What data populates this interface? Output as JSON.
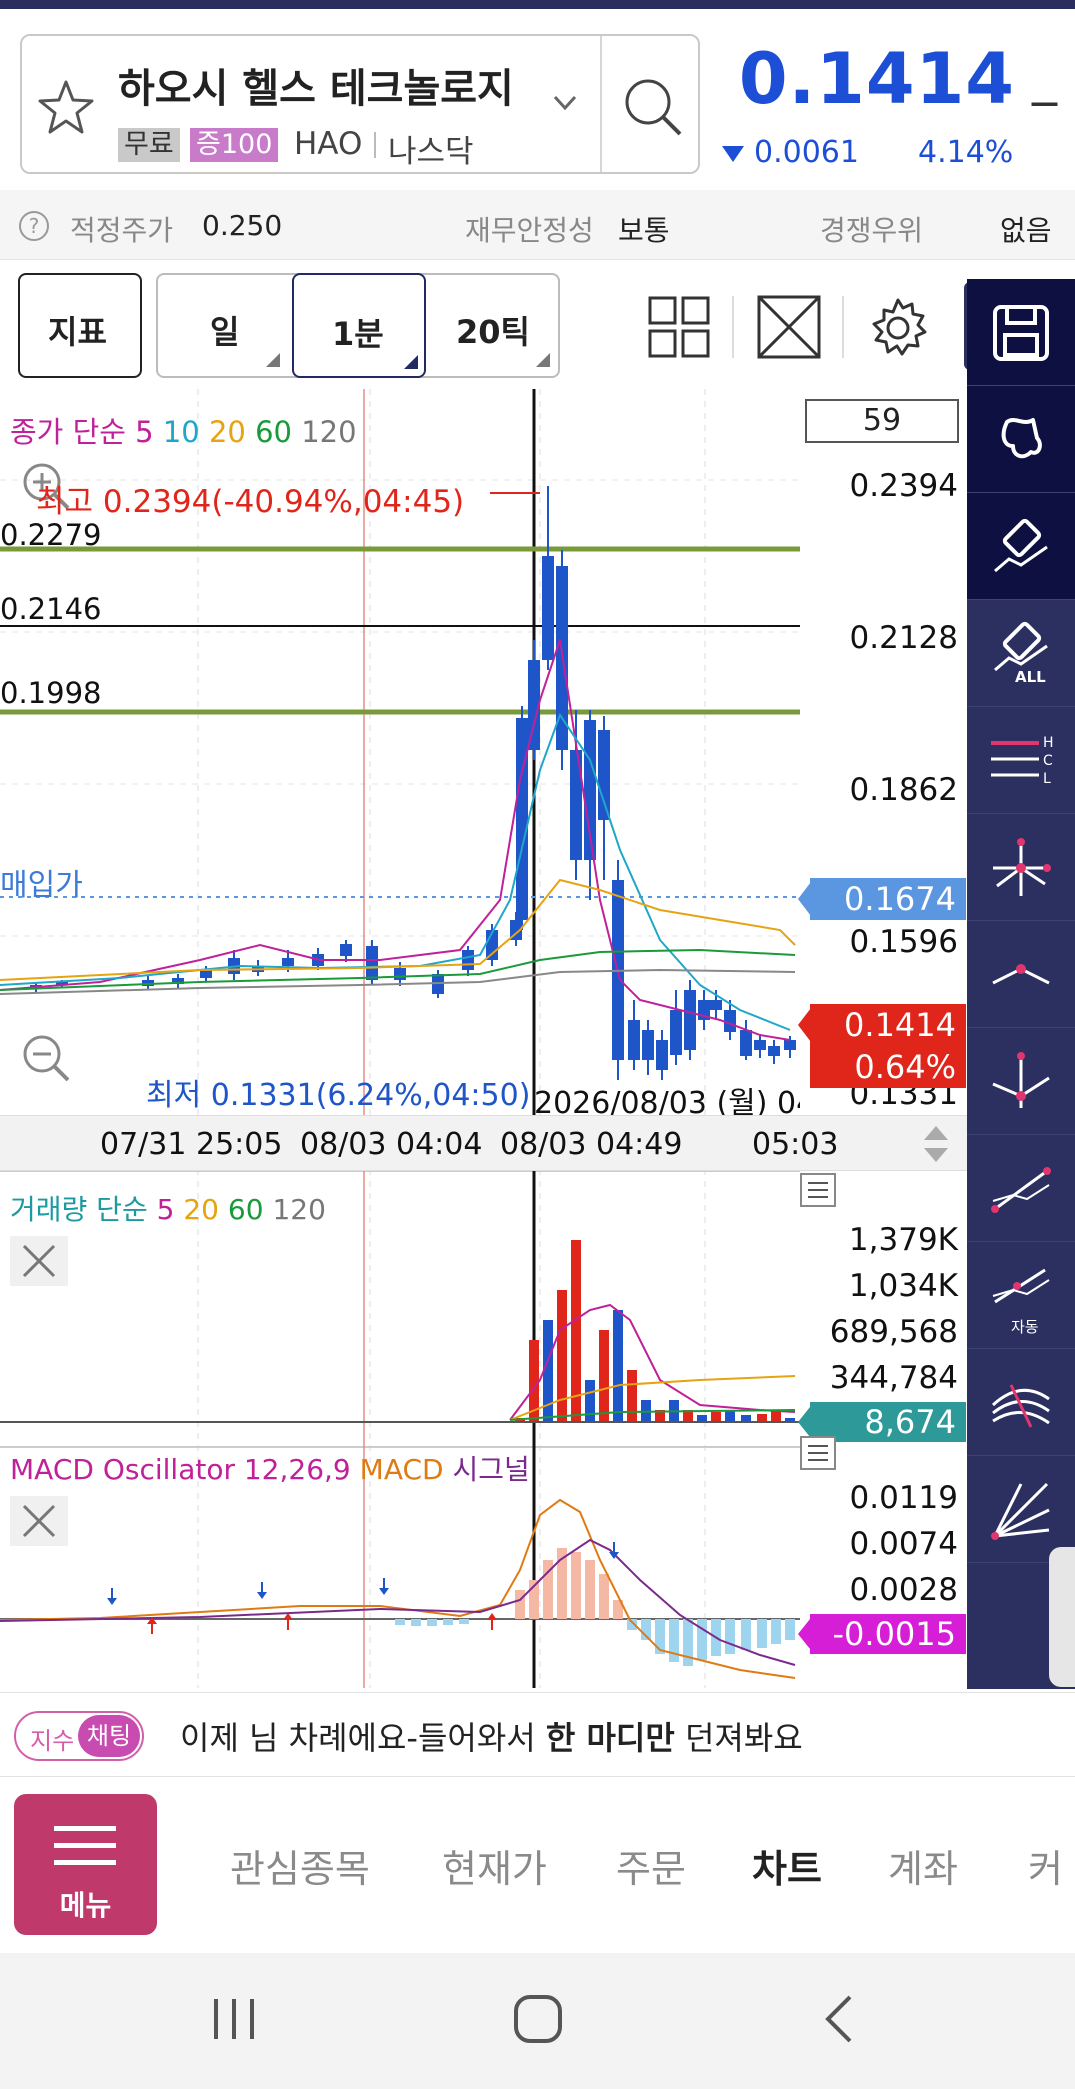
{
  "stock": {
    "name": "하오시 헬스 테크놀로지",
    "tag_free": "무료",
    "tag_margin": "증100",
    "ticker": "HAO",
    "exchange": "나스닥",
    "price": "0.1414",
    "price_suffix": "_",
    "change": "0.0061",
    "change_pct": "4.14%"
  },
  "info": {
    "fair_price_label": "적정주가",
    "fair_price": "0.250",
    "stability_label": "재무안정성",
    "stability": "보통",
    "advantage_label": "경쟁우위",
    "advantage": "없음"
  },
  "toolbar": {
    "indicator": "지표",
    "day": "일",
    "minute": "1분",
    "tick": "20틱"
  },
  "main_chart": {
    "count_box": "59",
    "ma_legend": {
      "label": "종가 단순",
      "p5": "5",
      "p10": "10",
      "p20": "20",
      "p60": "60",
      "p120": "120"
    },
    "high_note": "최고 0.2394(-40.94%,04:45)",
    "low_note": "최저 0.1331(6.24%,04:50)",
    "line_labels": [
      "0.2279",
      "0.2146",
      "0.1998"
    ],
    "buy_price_label": "매입가",
    "y_labels": [
      "0.2394",
      "0.2128",
      "0.1862",
      "0.1596",
      "0.1331"
    ],
    "avg_price_tag": "0.1674",
    "current_tag": "0.1414",
    "current_pct_tag": "0.64%",
    "crosshair_date": "2026/08/03 (월) 04",
    "x_labels": [
      "07/31 25:05",
      "08/03 04:04",
      "08/03 04:49",
      "05:03"
    ]
  },
  "volume_chart": {
    "legend": {
      "label": "거래량 단순",
      "p5": "5",
      "p20": "20",
      "p60": "60",
      "p120": "120"
    },
    "y_labels": [
      "1,379K",
      "1,034K",
      "689,568",
      "344,784"
    ],
    "current_tag": "8,674"
  },
  "macd_chart": {
    "legend_osc": "MACD Oscillator 12,26,9",
    "legend_macd": "MACD",
    "legend_signal": "시그널",
    "y_labels": [
      "0.0119",
      "0.0074",
      "0.0028"
    ],
    "current_tag": "-0.0015"
  },
  "chat": {
    "pill_a": "지수",
    "pill_b": "채팅",
    "msg_prefix": "이제 님 차례에요-들어와서 ",
    "msg_bold": "한 마디만",
    "msg_suffix": " 던져봐요"
  },
  "nav": {
    "menu": "메뉴",
    "items": [
      "관심종목",
      "현재가",
      "주문",
      "차트",
      "계좌",
      "커"
    ]
  },
  "sidebar_icons": [
    "save-icon",
    "flag-icon",
    "eraser-icon",
    "eraser-all-icon",
    "hcl-icon",
    "cross-point-icon",
    "peak-line-icon",
    "trend-point-icon",
    "trend-line-icon",
    "auto-trend-icon",
    "fan-icon",
    "ray-icon"
  ],
  "sidebar_auto_label": "자동",
  "sidebar_all_label": "ALL",
  "colors": {
    "brand_blue": "#1d4fd6",
    "up_red": "#e0261b",
    "down_blue": "#1e55c8",
    "sidebar": "#2c3060",
    "menu": "#c0396b"
  }
}
